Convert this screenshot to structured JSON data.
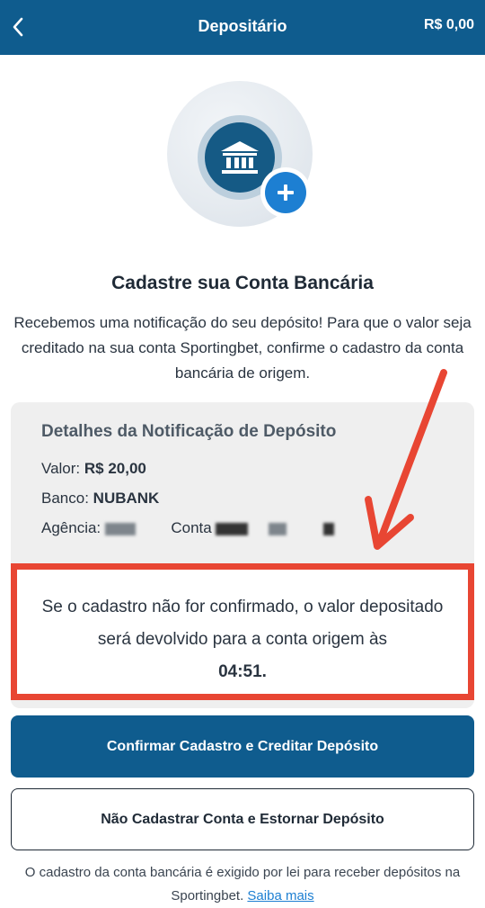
{
  "header": {
    "title": "Depositário",
    "balance": "R$ 0,00",
    "back_icon": "chevron-left-icon"
  },
  "hero": {
    "icon": "bank-icon",
    "badge_icon": "plus-icon"
  },
  "headline": "Cadastre sua Conta Bancária",
  "intro": "Recebemos uma notificação do seu depósito! Para que o valor seja creditado na sua conta Sportingbet, confirme o cadastro da conta bancária de origem.",
  "details": {
    "title": "Detalhes da Notificação de Depósito",
    "valor_label": "Valor:",
    "valor_value": "R$ 20,00",
    "banco_label": "Banco:",
    "banco_value": "NUBANK",
    "agencia_label": "Agência:",
    "conta_label": "Conta"
  },
  "warning": {
    "text": "Se o cadastro não for confirmado, o valor depositado será devolvido para a conta origem às",
    "time": "04:51."
  },
  "buttons": {
    "confirm": "Confirmar Cadastro e Creditar Depósito",
    "decline": "Não Cadastrar Conta e Estornar Depósito"
  },
  "footer": {
    "text": "O cadastro da conta bancária é exigido por lei para receber depósitos na Sportingbet.",
    "link": "Saiba mais"
  },
  "colors": {
    "brand": "#0f5c8e",
    "accent": "#1d7fd2",
    "annotation": "#e84633"
  }
}
